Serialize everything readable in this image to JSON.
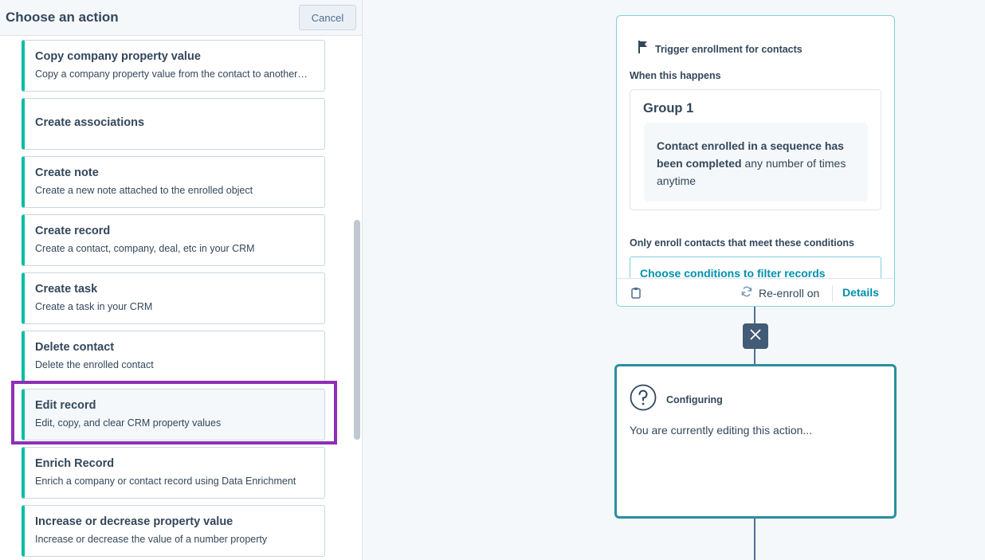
{
  "panel": {
    "title": "Choose an action",
    "cancel_label": "Cancel"
  },
  "actions": [
    {
      "title": "Copy company property value",
      "desc": "Copy a company property value from the contact to another…"
    },
    {
      "title": "Create associations",
      "desc": ""
    },
    {
      "title": "Create note",
      "desc": "Create a new note attached to the enrolled object"
    },
    {
      "title": "Create record",
      "desc": "Create a contact, company, deal, etc in your CRM"
    },
    {
      "title": "Create task",
      "desc": "Create a task in your CRM"
    },
    {
      "title": "Delete contact",
      "desc": "Delete the enrolled contact"
    },
    {
      "title": "Edit record",
      "desc": "Edit, copy, and clear CRM property values"
    },
    {
      "title": "Enrich Record",
      "desc": "Enrich a company or contact record using Data Enrichment"
    },
    {
      "title": "Increase or decrease property value",
      "desc": "Increase or decrease the value of a number property"
    }
  ],
  "trigger": {
    "title": "Trigger enrollment for contacts",
    "when_label": "When this happens",
    "group_title": "Group 1",
    "criteria_bold": "Contact enrolled in a sequence has been completed",
    "criteria_rest": " any number of times anytime",
    "only_enroll_label": "Only enroll contacts that meet these conditions",
    "filter_link": "Choose conditions to filter records",
    "reenroll_label": "Re-enroll on",
    "details_label": "Details"
  },
  "config": {
    "title": "Configuring",
    "text": "You are currently editing this action..."
  },
  "colors": {
    "accent_teal": "#00bda5",
    "link_blue": "#0091ae",
    "highlight_purple": "#8e2fb8",
    "card_border": "#2a8ea0"
  }
}
